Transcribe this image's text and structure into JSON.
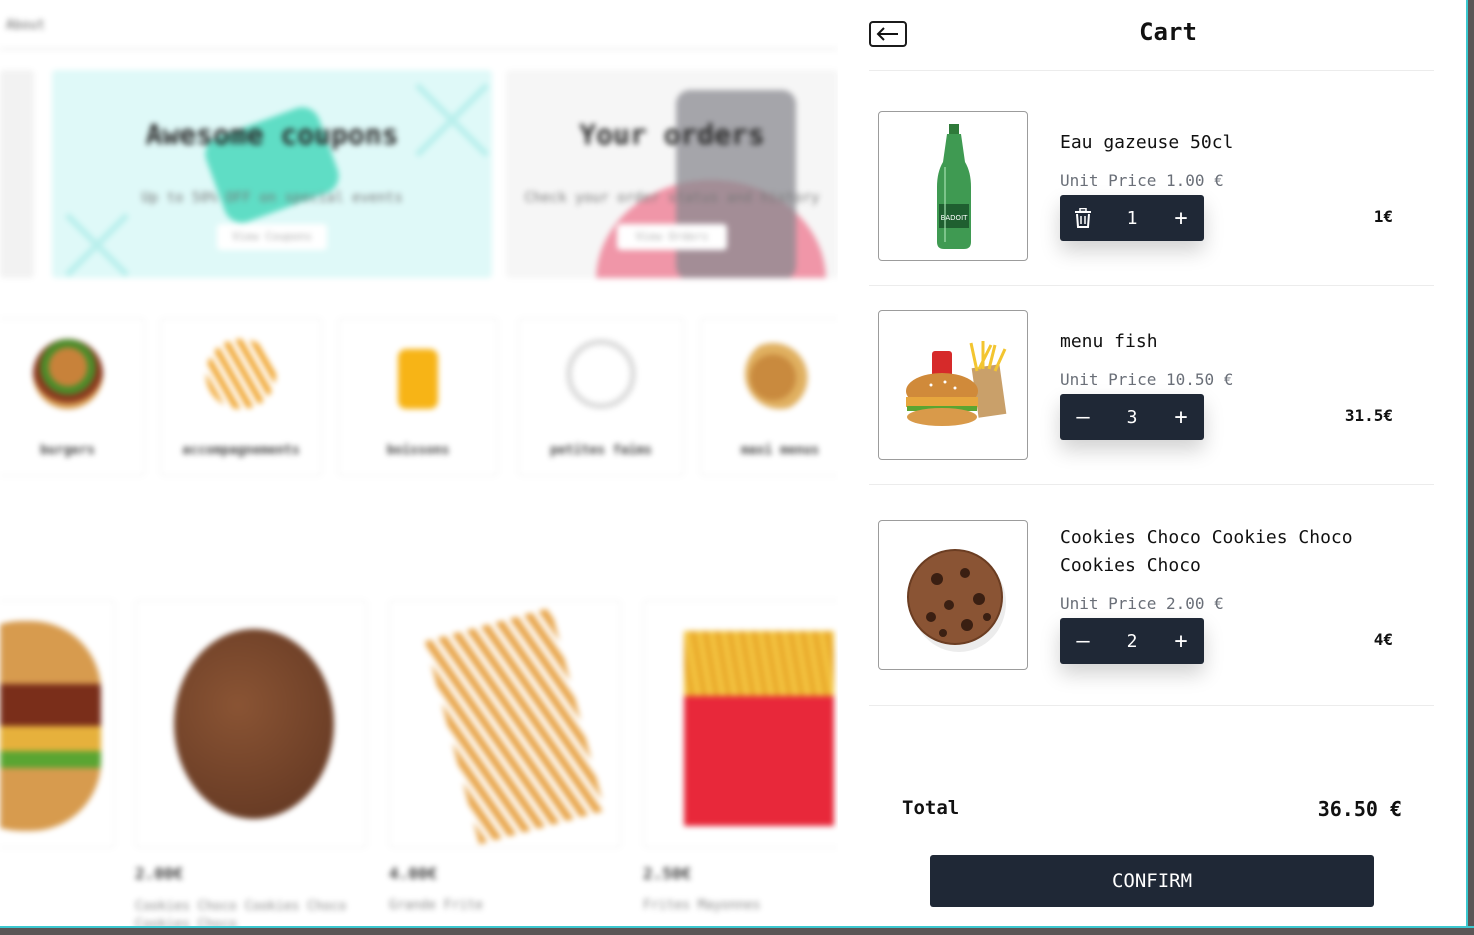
{
  "background": {
    "nav_link": "About",
    "promos": [
      {
        "title": "Awesome coupons",
        "subtitle": "Up to 50% OFF on special events",
        "button": "View Coupons"
      },
      {
        "title": "Your orders",
        "subtitle": "Check your order status and history",
        "button": "View Orders"
      }
    ],
    "categories": [
      {
        "label": "burgers",
        "icon": "burger-icon"
      },
      {
        "label": "accompagnements",
        "icon": "fries-icon"
      },
      {
        "label": "boissons",
        "icon": "drink-icon"
      },
      {
        "label": "petites faims",
        "icon": "plate-icon"
      },
      {
        "label": "maxi menus",
        "icon": "menu-icon"
      }
    ],
    "products": [
      {
        "price": "",
        "name": ""
      },
      {
        "price": "2.00€",
        "name": "Cookies Choco Cookies Choco Cookies Choco"
      },
      {
        "price": "4.00€",
        "name": "Grande Frite"
      },
      {
        "price": "2.50€",
        "name": "Frites Mayonnes"
      }
    ]
  },
  "cart": {
    "title": "Cart",
    "back_icon": "arrow-left-icon",
    "items": [
      {
        "name": "Eau gazeuse 50cl",
        "unit_price": "Unit Price 1.00 €",
        "quantity": "1",
        "line_total": "1€",
        "minus_icon": "trash-icon"
      },
      {
        "name": "menu fish",
        "unit_price": "Unit Price 10.50 €",
        "quantity": "3",
        "line_total": "31.5€",
        "minus_icon": "minus-icon"
      },
      {
        "name": "Cookies Choco Cookies Choco Cookies Choco",
        "unit_price": "Unit Price 2.00 €",
        "quantity": "2",
        "line_total": "4€",
        "minus_icon": "minus-icon"
      }
    ],
    "total_label": "Total",
    "total_value": "36.50 €",
    "confirm_label": "CONFIRM"
  },
  "colors": {
    "primary_dark": "#1f2836",
    "accent_teal": "#3cc8d0",
    "promo_mint": "#dff9f8"
  }
}
